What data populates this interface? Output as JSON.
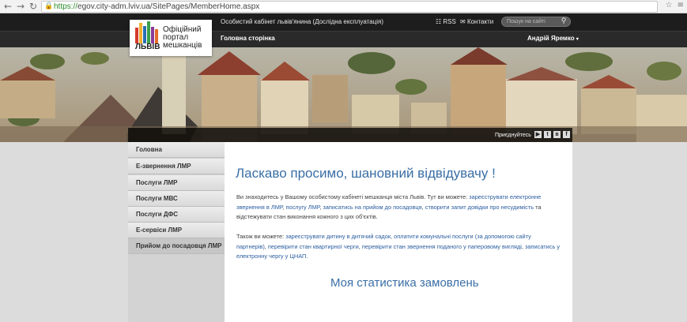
{
  "browser": {
    "url_scheme": "https://",
    "url_rest": "egov.city-adm.lviv.ua/SitePages/MemberHome.aspx"
  },
  "topbar": {
    "cabinet_title": "Особистий кабінет львів'янина (Дослідна експлуатація)",
    "rss": "RSS",
    "contacts": "Контакти",
    "search_placeholder": "Пошук на сайті"
  },
  "nav": {
    "home": "Головна сторінка",
    "user": "Андрій Яремко"
  },
  "logo": {
    "word": "ЛЬВІВ",
    "line1": "Офіційний",
    "line2": "портал",
    "line3": "мешканців"
  },
  "social": {
    "join": "Приєднуйтесь"
  },
  "sidebar": {
    "items": [
      {
        "label": "Головна"
      },
      {
        "label": "Е-звернення ЛМР"
      },
      {
        "label": "Послуги ЛМР"
      },
      {
        "label": "Послуги МВС"
      },
      {
        "label": "Послуги ДФС"
      },
      {
        "label": "Е-сервіси ЛМР"
      },
      {
        "label": "Прийом до посадовця ЛМР"
      }
    ]
  },
  "main": {
    "welcome": "Ласкаво просимо, шановний відвідувачу !",
    "p1_a": "Ви знаходитесь у Вашому особистому кабінеті мешканця міста Львів. Тут ви можете: ",
    "p1_link1": "зареєструвати електронне звернення в ЛМР",
    "p1_b": ", ",
    "p1_link2": "послугу ЛМР",
    "p1_c": ", ",
    "p1_link3": "записатись на прийом до посадовця",
    "p1_d": ", ",
    "p1_link4": "створити запит довідки про несудимість",
    "p1_e": " та відстежувати стан виконання кожного з цих об'єктів.",
    "p2_a": "Також ви можете: ",
    "p2_link1": "зареєструвати дитину в дитячий садок",
    "p2_b": ", ",
    "p2_link2": "оплатити комунальні послуги (за допомогою сайту партнерів)",
    "p2_c": ", ",
    "p2_link3": "перевірити стан квартирної черги",
    "p2_d": ", ",
    "p2_link4": "перевірити стан звернення поданого у паперовому вигляді",
    "p2_e": ", ",
    "p2_link5": "записатись у електронну чергу у ЦНАП",
    "p2_f": ".",
    "stats_title": "Моя статистика замовлень"
  }
}
